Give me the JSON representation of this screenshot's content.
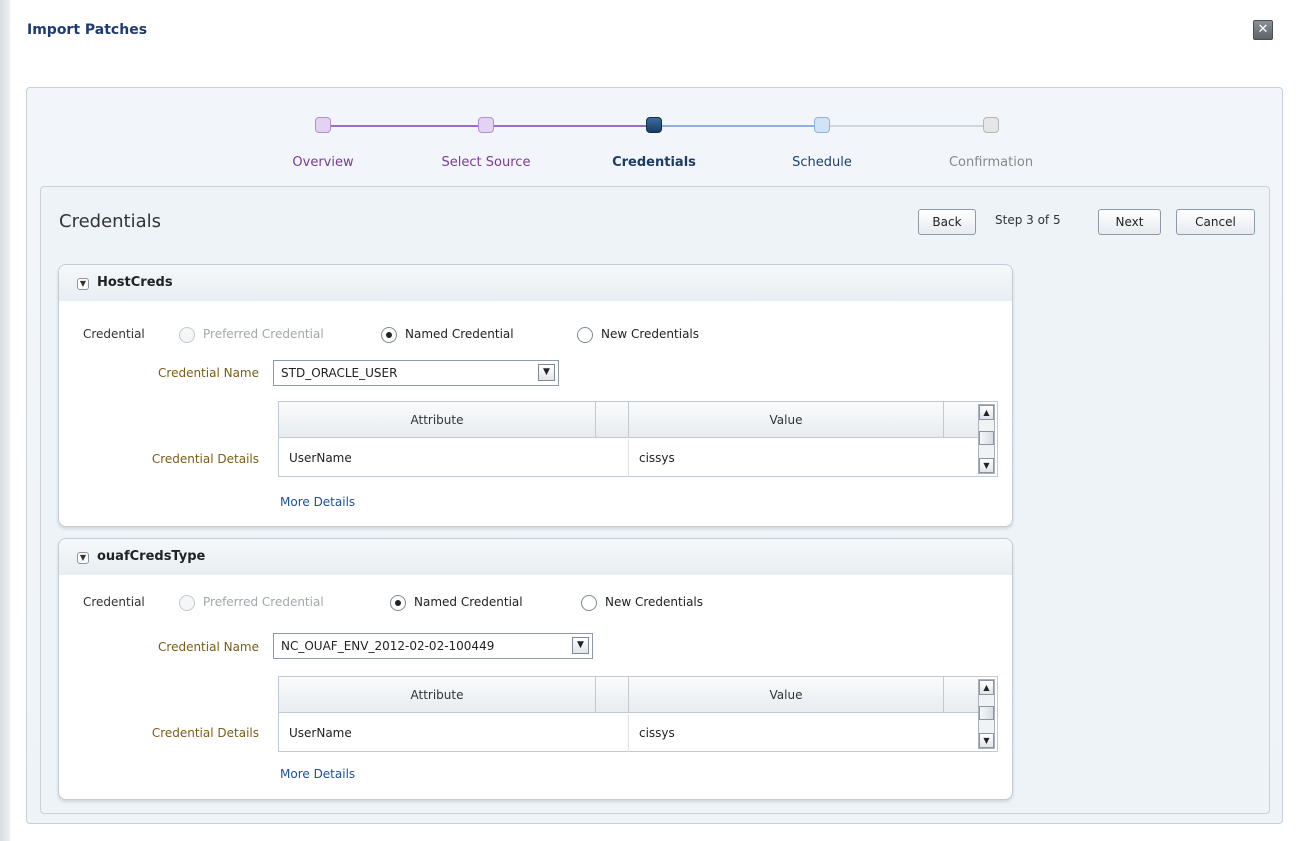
{
  "dialog": {
    "title": "Import Patches",
    "close_symbol": "✕"
  },
  "train": {
    "steps": [
      {
        "label": "Overview",
        "state": "visited"
      },
      {
        "label": "Select Source",
        "state": "visited"
      },
      {
        "label": "Credentials",
        "state": "current"
      },
      {
        "label": "Schedule",
        "state": "next"
      },
      {
        "label": "Confirmation",
        "state": "disabled"
      }
    ]
  },
  "page": {
    "heading": "Credentials",
    "back_label": "Back",
    "step_text": "Step 3 of 5",
    "next_label": "Next",
    "cancel_label": "Cancel"
  },
  "regions": [
    {
      "title": "HostCreds",
      "credential_label": "Credential",
      "options": [
        "Preferred Credential",
        "Named Credential",
        "New Credentials"
      ],
      "selected_option": "Named Credential",
      "credential_name_label": "Credential Name",
      "credential_name_value": "STD_ORACLE_USER",
      "credential_details_label": "Credential Details",
      "table": {
        "headers": [
          "Attribute",
          "Value"
        ],
        "rows": [
          [
            "UserName",
            "cissys"
          ]
        ]
      },
      "more_details_label": "More Details"
    },
    {
      "title": "ouafCredsType",
      "credential_label": "Credential",
      "options": [
        "Preferred Credential",
        "Named Credential",
        "New Credentials"
      ],
      "selected_option": "Named Credential",
      "credential_name_label": "Credential Name",
      "credential_name_value": "NC_OUAF_ENV_2012-02-02-100449",
      "credential_details_label": "Credential Details",
      "table": {
        "headers": [
          "Attribute",
          "Value"
        ],
        "rows": [
          [
            "UserName",
            "cissys"
          ]
        ]
      },
      "more_details_label": "More Details"
    }
  ],
  "icons": {
    "disclose": "chevron-down-icon",
    "select_arrow": "chevron-down-icon",
    "scroll_up": "triangle-up-icon",
    "scroll_down": "triangle-down-icon"
  },
  "colors": {
    "title": "#1f3a73",
    "train_visited": "#7a3a98",
    "train_current": "#1c3c68",
    "field_label": "#7a5e14",
    "link": "#1f4e9c"
  }
}
